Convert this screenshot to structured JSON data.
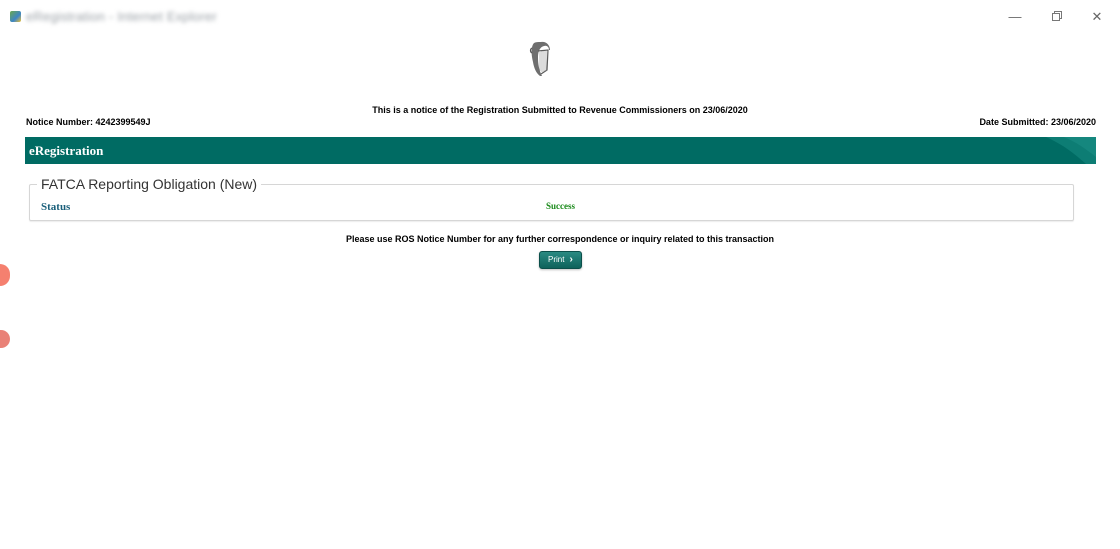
{
  "window": {
    "title": "eRegistration - Internet Explorer",
    "minimize_label": "—",
    "close_label": "✕",
    "app_icon": "internet-explorer-icon",
    "maximize_icon": "restore-icon"
  },
  "crest": {
    "icon": "harp-emblem-icon"
  },
  "notice": {
    "intro": "This is a notice of the Registration Submitted to Revenue Commissioners on  23/06/2020",
    "number_label": "Notice Number:  4242399549J",
    "date_label": "Date Submitted:  23/06/2020"
  },
  "banner": {
    "title": "eRegistration",
    "color": "#006b63"
  },
  "section": {
    "legend": "FATCA Reporting Obligation (New)",
    "status_label": "Status",
    "status_value": "Success",
    "status_color": "#1a8a1a"
  },
  "footer": {
    "hint": "Please use ROS Notice Number for any further correspondence or inquiry related to this transaction",
    "print_label": "Print",
    "print_icon": "chevron-right-icon"
  }
}
